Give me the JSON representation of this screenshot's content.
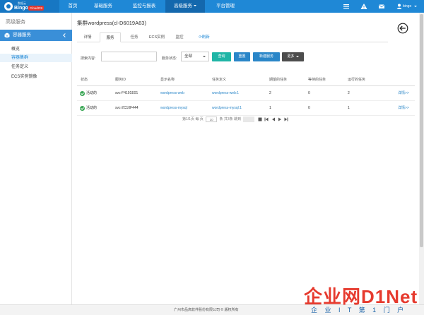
{
  "logo": {
    "brand": "Bingo",
    "small": "数据云",
    "badge": "CloudOS"
  },
  "nav": {
    "items": [
      "首页",
      "基础服务",
      "监控与报表",
      "高级服务",
      "平台管理"
    ],
    "user": "bingo"
  },
  "sidebar": {
    "title": "高级服务",
    "section": "容器服务",
    "items": [
      "概览",
      "容器集群",
      "任务定义",
      "ECS实例镜像"
    ]
  },
  "main": {
    "cluster_title": "集群wordpress(cl-D6019A63)",
    "tabs": [
      "详情",
      "服务",
      "任务",
      "ECS实例",
      "监控"
    ],
    "refresh": "⟳刷新",
    "search_label": "搜索内容:",
    "search_placeholder": "",
    "status_label": "服务状态:",
    "status_value": "全部",
    "buttons": {
      "query": "查询",
      "reset": "重置",
      "new_service": "新建服务",
      "more": "更多"
    }
  },
  "table": {
    "headers": [
      "状态",
      "服务ID",
      "显示名称",
      "任务定义",
      "期望的任务",
      "等待的任务",
      "运行的任务"
    ],
    "rows": [
      {
        "status": "活动的",
        "id": "svc-F4191E01",
        "name": "wordpress-web",
        "task_def": "wordpress-web:1",
        "desired": "2",
        "pending": "0",
        "running": "2",
        "action": "详情>>"
      },
      {
        "status": "活动的",
        "id": "svc-2C10F444",
        "name": "wordpress-mysql",
        "task_def": "wordpress-mysql:1",
        "desired": "1",
        "pending": "0",
        "running": "1",
        "action": "详情>>"
      }
    ]
  },
  "pager": {
    "text1": "第1/1页  每 页",
    "size": "10",
    "text2": "条  共3条 跳到"
  },
  "footer": {
    "copyright": "广州市品高软件股份有限公司 © 版权所有"
  },
  "watermark": {
    "main": "企业网D1Net",
    "sub": "企 业 I T 第 1 门 户"
  },
  "colors": {
    "nav": "#1f88d6",
    "accent": "#3a8fd8",
    "green": "#1fb5a6",
    "blue": "#2a86c8",
    "watermark": "#e63a2e"
  }
}
